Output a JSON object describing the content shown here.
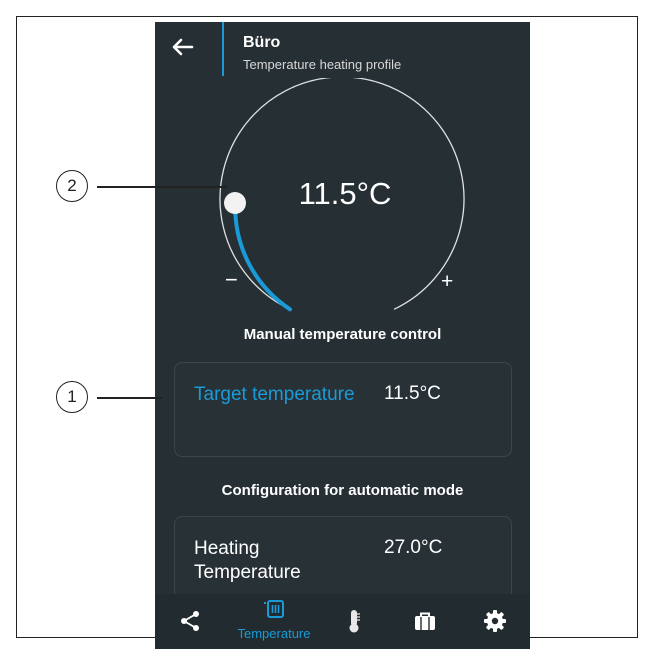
{
  "header": {
    "title": "Büro",
    "subtitle": "Temperature heating profile"
  },
  "dial": {
    "current_temp": "11.5°C",
    "minus_label": "−",
    "plus_label": "+"
  },
  "manual": {
    "section_title": "Manual temperature control",
    "target_label": "Target temperature",
    "target_value": "11.5°C"
  },
  "automatic": {
    "section_title": "Configuration for automatic mode",
    "heating_label": "Heating Temperature",
    "heating_value": "27.0°C"
  },
  "tabs": {
    "temperature_label": "Temperature"
  },
  "callouts": {
    "one": "1",
    "two": "2"
  },
  "colors": {
    "accent": "#1a9bd7",
    "background": "#263034",
    "text": "#ffffff"
  }
}
